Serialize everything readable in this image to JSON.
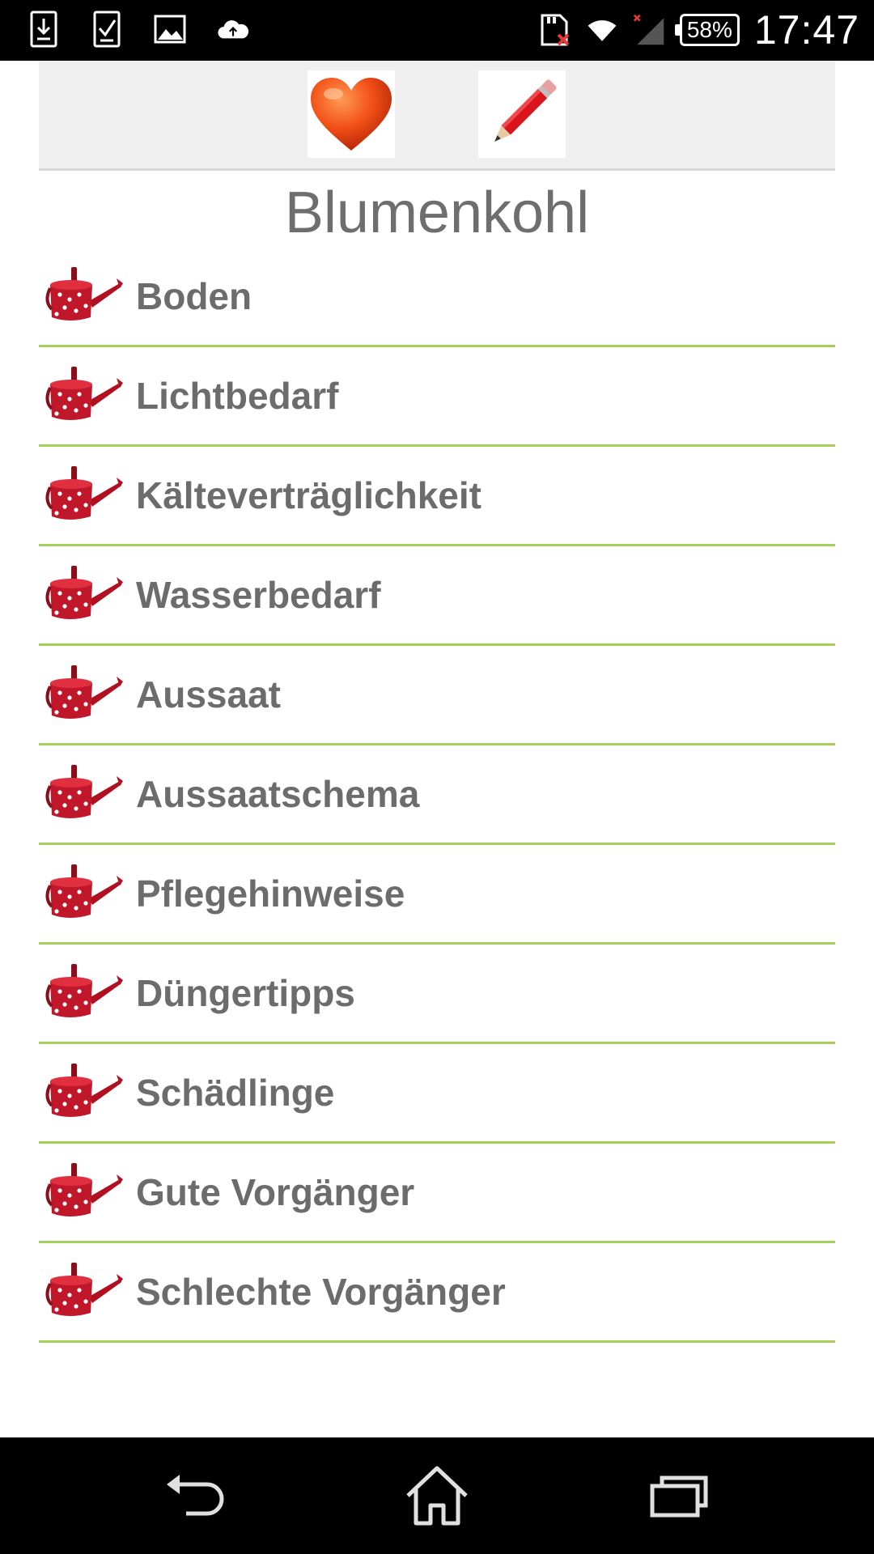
{
  "status_bar": {
    "battery_text": "58%",
    "time": "17:47",
    "left_icons": [
      "download-icon",
      "task-check-icon",
      "image-icon",
      "cloud-upload-icon"
    ],
    "right_icons": [
      "sd-card-error-icon",
      "wifi-icon",
      "no-signal-icon",
      "battery-icon"
    ]
  },
  "toolbar": {
    "favorite_icon": "heart-icon",
    "edit_icon": "pencil-icon"
  },
  "page": {
    "title": "Blumenkohl"
  },
  "list": {
    "item_icon": "watering-can-icon",
    "items": [
      {
        "label": "Boden"
      },
      {
        "label": "Lichtbedarf"
      },
      {
        "label": "Kälteverträglichkeit"
      },
      {
        "label": "Wasserbedarf"
      },
      {
        "label": "Aussaat"
      },
      {
        "label": "Aussaatschema"
      },
      {
        "label": "Pflegehinweise"
      },
      {
        "label": "Düngertipps"
      },
      {
        "label": "Schädlinge"
      },
      {
        "label": "Gute Vorgänger"
      },
      {
        "label": "Schlechte Vorgänger"
      }
    ]
  },
  "nav_bar": {
    "icons": [
      "back-icon",
      "home-icon",
      "recent-apps-icon"
    ]
  },
  "colors": {
    "status_bar": "#000000",
    "divider": "#a4cf5a",
    "text": "#6c6c6c",
    "toolbar_bg": "#efefef",
    "watering_can": "#c0182a"
  }
}
